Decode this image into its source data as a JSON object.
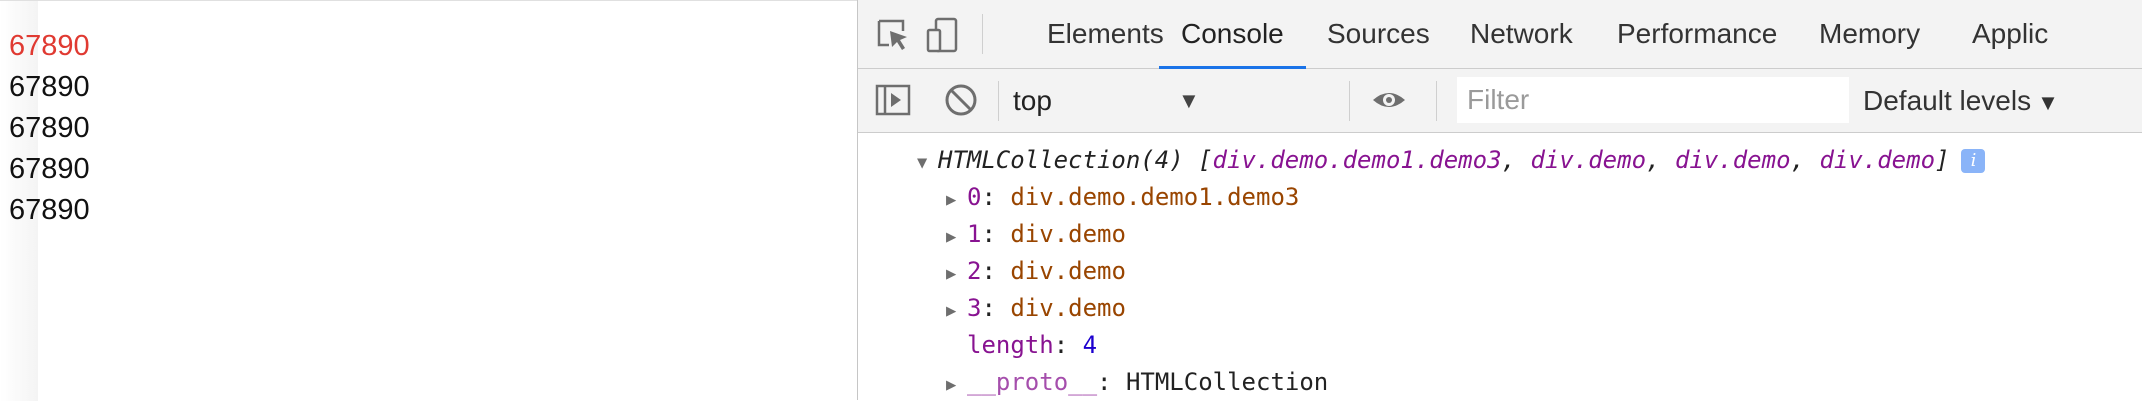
{
  "page": {
    "demo_items": [
      "67890",
      "67890",
      "67890",
      "67890",
      "67890"
    ]
  },
  "devtools": {
    "tabs": [
      "Elements",
      "Console",
      "Sources",
      "Network",
      "Performance",
      "Memory",
      "Applic"
    ],
    "active_tab": "Console",
    "toolbar": {
      "context": "top",
      "filter_placeholder": "Filter",
      "levels": "Default levels"
    },
    "console": {
      "collection": {
        "label": "HTMLCollection(4)",
        "open_bracket": "[",
        "items": [
          "div.demo.demo1.demo3",
          "div.demo",
          "div.demo",
          "div.demo"
        ],
        "sep": ", ",
        "close_bracket": "]",
        "info_glyph": "i"
      },
      "entries": [
        {
          "key": "0",
          "value": "div.demo.demo1.demo3"
        },
        {
          "key": "1",
          "value": "div.demo"
        },
        {
          "key": "2",
          "value": "div.demo"
        },
        {
          "key": "3",
          "value": "div.demo"
        }
      ],
      "length": {
        "key": "length",
        "value": "4"
      },
      "proto": {
        "key": "__proto__",
        "value": "HTMLCollection"
      },
      "colon": ": "
    }
  },
  "colors": {
    "first_item": "#e03a32",
    "active_tab_underline": "#1a73e8",
    "purple_key": "#881391",
    "brown_value": "#994500",
    "number": "#1c00cf"
  },
  "icons": [
    "inspect-element-icon",
    "device-toolbar-icon",
    "sidebar-toggle-icon",
    "clear-console-icon",
    "eye-icon",
    "dropdown-caret-icon",
    "expand-triangle-icon",
    "info-icon"
  ]
}
